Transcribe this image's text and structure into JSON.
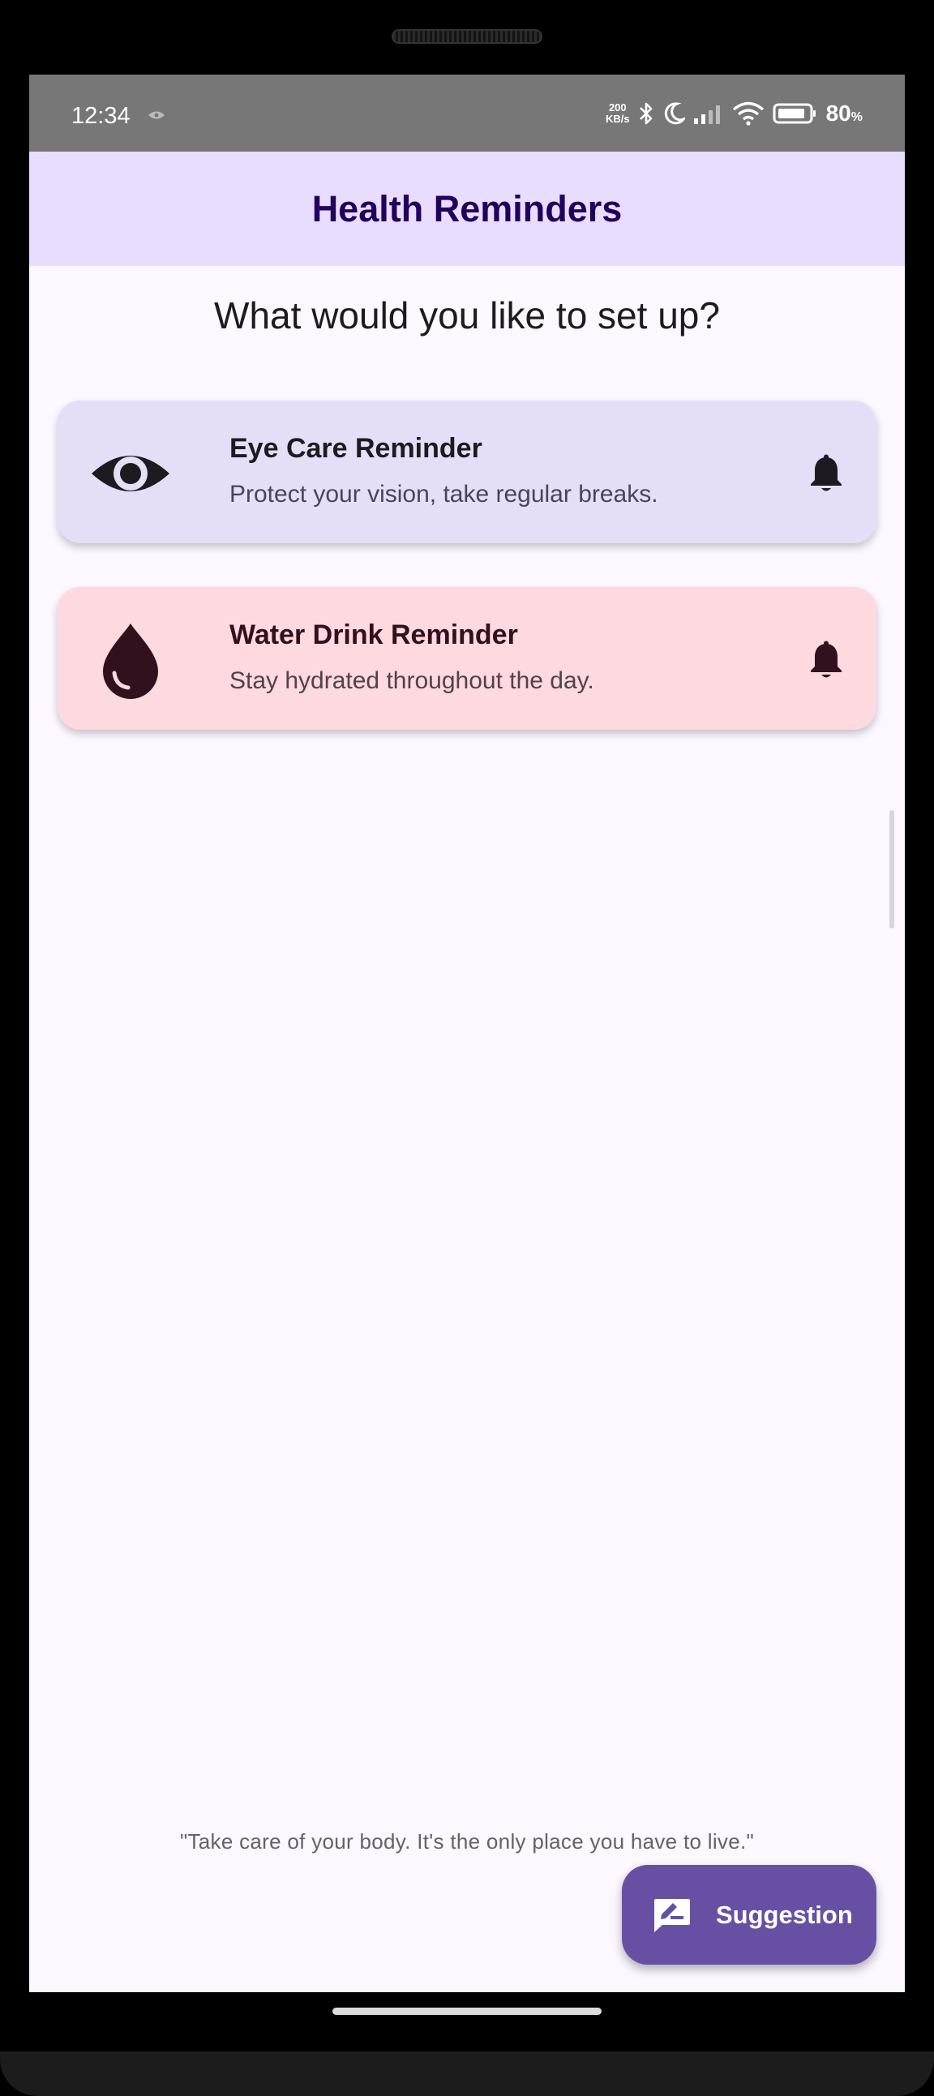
{
  "status_bar": {
    "time": "12:34",
    "net_speed_value": "200",
    "net_speed_unit": "KB/s",
    "battery_percent": "80",
    "battery_unit": "%",
    "icons": [
      "eye-icon",
      "bluetooth-icon",
      "moon-icon",
      "signal-icon",
      "wifi-icon",
      "battery-icon"
    ]
  },
  "app_bar": {
    "title": "Health Reminders"
  },
  "main": {
    "prompt": "What would you like to set up?",
    "cards": [
      {
        "title": "Eye Care Reminder",
        "description": "Protect your vision, take regular breaks.",
        "icon": "eye-icon",
        "action_icon": "bell-icon",
        "color": "#E6DEF6"
      },
      {
        "title": "Water Drink Reminder",
        "description": "Stay hydrated throughout the day.",
        "icon": "water-drop-icon",
        "action_icon": "bell-icon",
        "color": "#FFD9E0"
      }
    ],
    "quote": "\"Take care of your body. It's the only place you have to live.\""
  },
  "fab": {
    "label": "Suggestion",
    "icon": "feedback-icon",
    "color": "#6750A4"
  }
}
